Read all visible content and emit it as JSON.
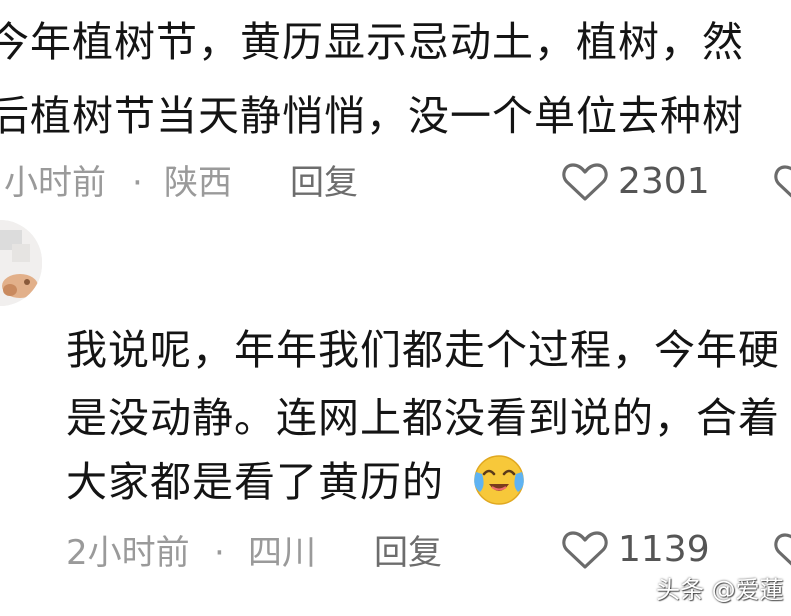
{
  "comments": [
    {
      "lines": [
        "今年植树节，黄历显示忌动土，植树，然",
        "后植树节当天静悄悄，没一个单位去种树"
      ],
      "time": "小时前",
      "separator": "·",
      "location": "陕西",
      "reply_label": "回复",
      "likes": "2301"
    },
    {
      "lines": [
        "我说呢，年年我们都走个过程，今年硬",
        "是没动静。连网上都没看到说的，合着",
        "大家都是看了黄历的"
      ],
      "emoji": "crying-laughing-emoji",
      "time": "2小时前",
      "separator": "·",
      "location": "四川",
      "reply_label": "回复",
      "likes": "1139"
    }
  ],
  "watermark": "头条 @爱蓮",
  "colors": {
    "text": "#141414",
    "meta": "#9a9a9a",
    "reply": "#6d6d6d",
    "count": "#555555"
  }
}
